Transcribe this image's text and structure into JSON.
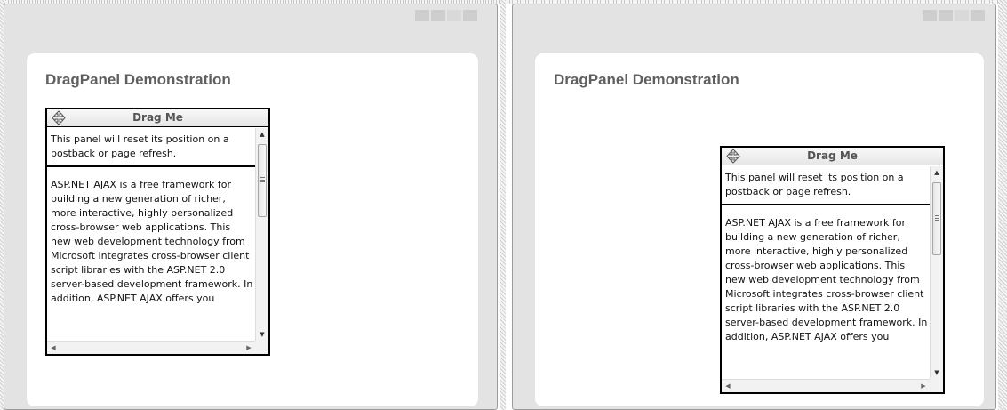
{
  "page": {
    "title": "DragPanel Demonstration",
    "accent": "#5f5f5f"
  },
  "panel": {
    "handle_label": "Drag Me",
    "handle_icon": "move-arrows-icon",
    "reset_note": "This panel will reset its position on a postback or page refresh.",
    "body_text": "ASP.NET AJAX is a free framework for building a new generation of richer, more interactive, highly personalized cross-browser web applications. This new web development technology from Microsoft integrates cross-browser client script libraries with the ASP.NET 2.0 server-based development framework. In addition, ASP.NET AJAX offers you"
  },
  "scrollbar": {
    "up": "▲",
    "down": "▼",
    "left": "◀",
    "right": "▶"
  }
}
